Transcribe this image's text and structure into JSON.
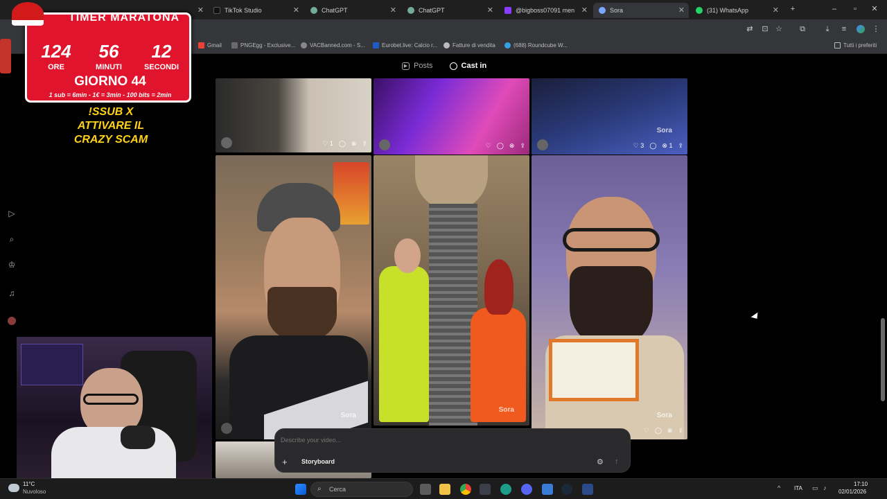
{
  "tabs": [
    {
      "label": "TIMER MARATONA",
      "color": "#e0142c"
    },
    {
      "label": "TikTok Studio",
      "color": "#111111"
    },
    {
      "label": "ChatGPT",
      "color": "#74aa9c"
    },
    {
      "label": "ChatGPT",
      "color": "#74aa9c"
    },
    {
      "label": "@bigboss07091 men",
      "color": "#8b3dff"
    },
    {
      "label": "Sora",
      "color": "#7aa7ff"
    },
    {
      "label": "(31) WhatsApp",
      "color": "#25d366"
    }
  ],
  "bookmarks": {
    "items": [
      "Gmail",
      "PNGEgg - Exclusive...",
      "VACBanned.com - S...",
      "Eurobet.live: Calcio r...",
      "Fatture di vendita",
      "(688) Roundcube W..."
    ],
    "right": "Tutti i preferiti"
  },
  "page": {
    "nav": {
      "posts": "Posts",
      "cast_in": "Cast in"
    },
    "top_tiles": [
      {
        "likes": "1",
        "remixes": ""
      },
      {
        "likes": "",
        "remixes": ""
      },
      {
        "likes": "3",
        "remixes": "1",
        "watermark": "Sora"
      }
    ],
    "main_tiles": [
      {
        "watermark": "Sora"
      },
      {
        "watermark": "Sora"
      },
      {
        "watermark": "Sora"
      }
    ],
    "prompt": {
      "placeholder": "Describe your video...",
      "storyboard": "Storyboard"
    }
  },
  "overlay": {
    "header": "TIMER MARATONA",
    "hours": "124",
    "minutes": "56",
    "seconds": "12",
    "hours_label": "ORE",
    "minutes_label": "MINUTI",
    "seconds_label": "SECONDI",
    "day": "GIORNO 44",
    "rates": "1 sub = 6min - 1€ = 3min - 100 bits = 2min",
    "call_line1": "!SSUB X",
    "call_line2": "ATTIVARE IL",
    "call_line3": "CRAZY SCAM"
  },
  "taskbar": {
    "temp": "11°C",
    "weather": "Nuvoloso",
    "search": "Cerca",
    "lang": "ITA",
    "time": "17:10",
    "date": "02/01/2026"
  }
}
